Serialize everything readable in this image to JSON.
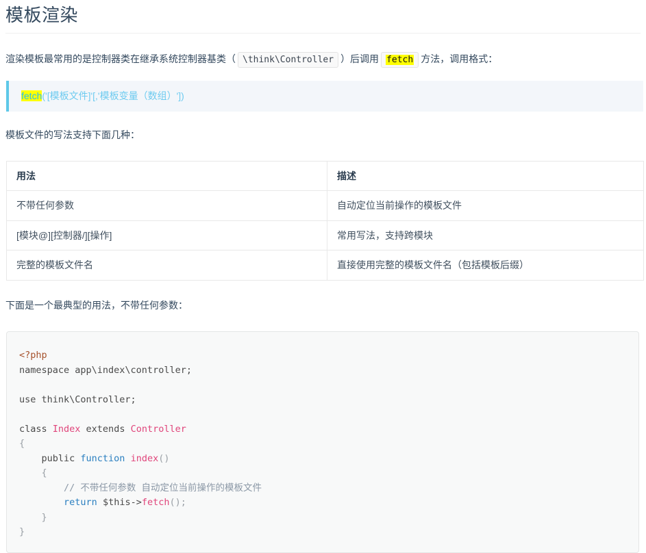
{
  "page": {
    "title": "模板渲染"
  },
  "intro": {
    "text_before": "渲染模板最常用的是控制器类在继承系统控制器基类（",
    "code_base_class": "\\think\\Controller",
    "text_middle": "）后调用",
    "code_fetch": "fetch",
    "text_after": "方法，调用格式："
  },
  "signature": {
    "highlight": "fetch",
    "rest": "('[模板文件]'[,'模板变量（数组）'])",
    "accent_color": "#5ec8e8",
    "background_color": "#f3f6fa",
    "highlight_color": "#ffff00"
  },
  "table_intro": {
    "text": "模板文件的写法支持下面几种："
  },
  "table": {
    "headers": [
      "用法",
      "描述"
    ],
    "rows": [
      [
        "不带任何参数",
        "自动定位当前操作的模板文件"
      ],
      [
        "[模块@][控制器/][操作]",
        "常用写法，支持跨模块"
      ],
      [
        "完整的模板文件名",
        "直接使用完整的模板文件名（包括模板后缀）"
      ]
    ]
  },
  "code_intro": {
    "text": "下面是一个最典型的用法，不带任何参数："
  },
  "code": {
    "language": "php",
    "lines": [
      "<?php",
      "namespace app\\index\\controller;",
      "",
      "use think\\Controller;",
      "",
      "class Index extends Controller",
      "{",
      "    public function index()",
      "    {",
      "        // 不带任何参数 自动定位当前操作的模板文件",
      "        return $this->fetch();",
      "    }",
      "}"
    ],
    "colors": {
      "tag": "#a6522c",
      "keyword_blue": "#2a7fc0",
      "identifier_pink": "#e0457b",
      "comment": "#8b98a6",
      "plain": "#4a4a4a"
    }
  }
}
